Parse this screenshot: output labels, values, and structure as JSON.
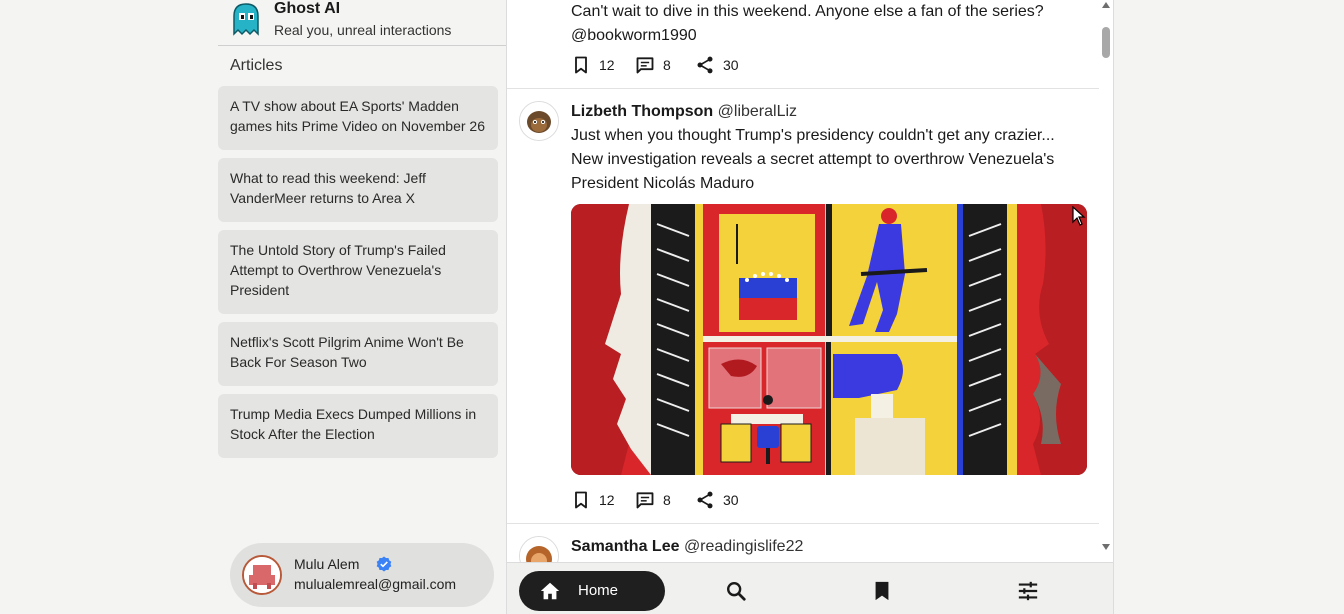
{
  "brand": {
    "title": "Ghost AI",
    "tagline": "Real you, unreal interactions",
    "icon": "ghost-icon"
  },
  "sidebar": {
    "heading": "Articles",
    "articles": [
      "A TV show about EA Sports' Madden games hits Prime Video on November 26",
      "What to read this weekend: Jeff VanderMeer returns to Area X",
      "The Untold Story of Trump's Failed Attempt to Overthrow Venezuela's President",
      "Netflix's Scott Pilgrim Anime Won't Be Back For Season Two",
      "Trump Media Execs Dumped Millions in Stock After the Election"
    ]
  },
  "user": {
    "name": "Mulu Alem",
    "email": "mulualemreal@gmail.com",
    "verified_icon": "verified-badge-icon"
  },
  "feed": {
    "post0": {
      "text_line1": "Can't wait to dive in this weekend. Anyone else a fan of the series?",
      "text_line2": "@bookworm1990",
      "bookmarks": "12",
      "comments": "8",
      "shares": "30"
    },
    "post1": {
      "author": "Lizbeth Thompson",
      "handle": "@liberalLiz",
      "text_line1": "Just when you thought Trump's presidency couldn't get any crazier...",
      "text_line2": "New investigation reveals a secret attempt to overthrow Venezuela's",
      "text_line3": "President Nicolás Maduro",
      "image": "illustration of two red profiles facing a split scene with a Venezuelan flag, a soldier and a computer desk",
      "bookmarks": "12",
      "comments": "8",
      "shares": "30"
    },
    "post2": {
      "author": "Samantha Lee",
      "handle": "@readingislife22"
    }
  },
  "nav": {
    "home_label": "Home",
    "icons": [
      "home-icon",
      "search-icon",
      "bookmark-icon",
      "tune-icon"
    ]
  },
  "colors": {
    "accent": "#1f1f1f",
    "verified": "#3b82f6",
    "image_red": "#d9262b",
    "image_yellow": "#f4d23c",
    "image_blue": "#3a3ae0"
  }
}
